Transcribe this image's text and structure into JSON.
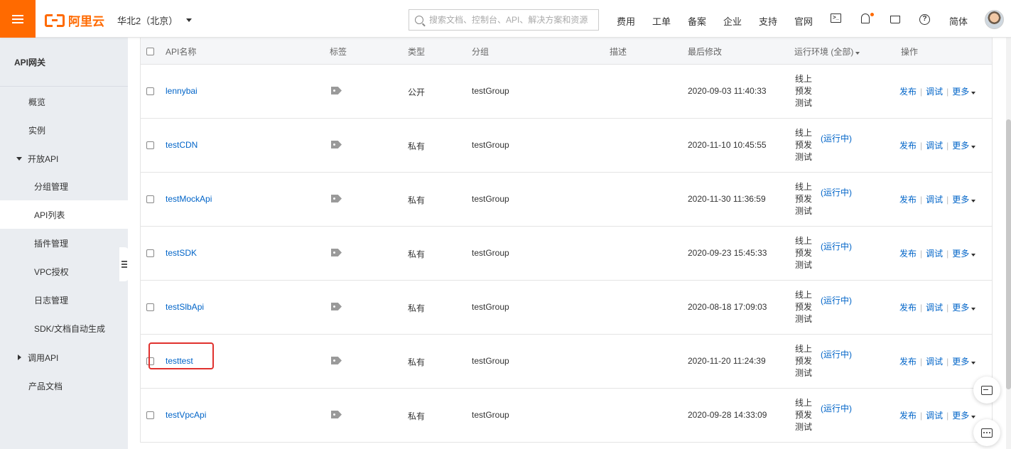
{
  "header": {
    "logo_text": "阿里云",
    "region": "华北2（北京）",
    "search_placeholder": "搜索文档、控制台、API、解决方案和资源",
    "nav": [
      "费用",
      "工单",
      "备案",
      "企业",
      "支持",
      "官网"
    ],
    "lang": "简体"
  },
  "sidebar": {
    "title": "API网关",
    "items": [
      {
        "label": "概览"
      },
      {
        "label": "实例"
      },
      {
        "label": "开放API"
      },
      {
        "label": "分组管理"
      },
      {
        "label": "API列表"
      },
      {
        "label": "插件管理"
      },
      {
        "label": "VPC授权"
      },
      {
        "label": "日志管理"
      },
      {
        "label": "SDK/文档自动生成"
      },
      {
        "label": "调用API"
      },
      {
        "label": "产品文档"
      }
    ]
  },
  "table": {
    "columns": [
      "API名称",
      "标签",
      "类型",
      "分组",
      "描述",
      "最后修改",
      "运行环境 (全部)",
      "操作"
    ],
    "env_labels": [
      "线上",
      "预发",
      "测试"
    ],
    "running_label": "(运行中)",
    "actions": {
      "publish": "发布",
      "debug": "调试",
      "more": "更多"
    },
    "rows": [
      {
        "name": "lennybai",
        "type": "公开",
        "group": "testGroup",
        "modified": "2020-09-03 11:40:33",
        "running": false
      },
      {
        "name": "testCDN",
        "type": "私有",
        "group": "testGroup",
        "modified": "2020-11-10 10:45:55",
        "running": true
      },
      {
        "name": "testMockApi",
        "type": "私有",
        "group": "testGroup",
        "modified": "2020-11-30 11:36:59",
        "running": true
      },
      {
        "name": "testSDK",
        "type": "私有",
        "group": "testGroup",
        "modified": "2020-09-23 15:45:33",
        "running": true
      },
      {
        "name": "testSlbApi",
        "type": "私有",
        "group": "testGroup",
        "modified": "2020-08-18 17:09:03",
        "running": true
      },
      {
        "name": "testtest",
        "type": "私有",
        "group": "testGroup",
        "modified": "2020-11-20 11:24:39",
        "running": true,
        "highlighted": true
      },
      {
        "name": "testVpcApi",
        "type": "私有",
        "group": "testGroup",
        "modified": "2020-09-28 14:33:09",
        "running": true
      }
    ]
  },
  "colors": {
    "brand": "#ff6a00",
    "link": "#0064c8",
    "highlight": "#e0312e"
  }
}
